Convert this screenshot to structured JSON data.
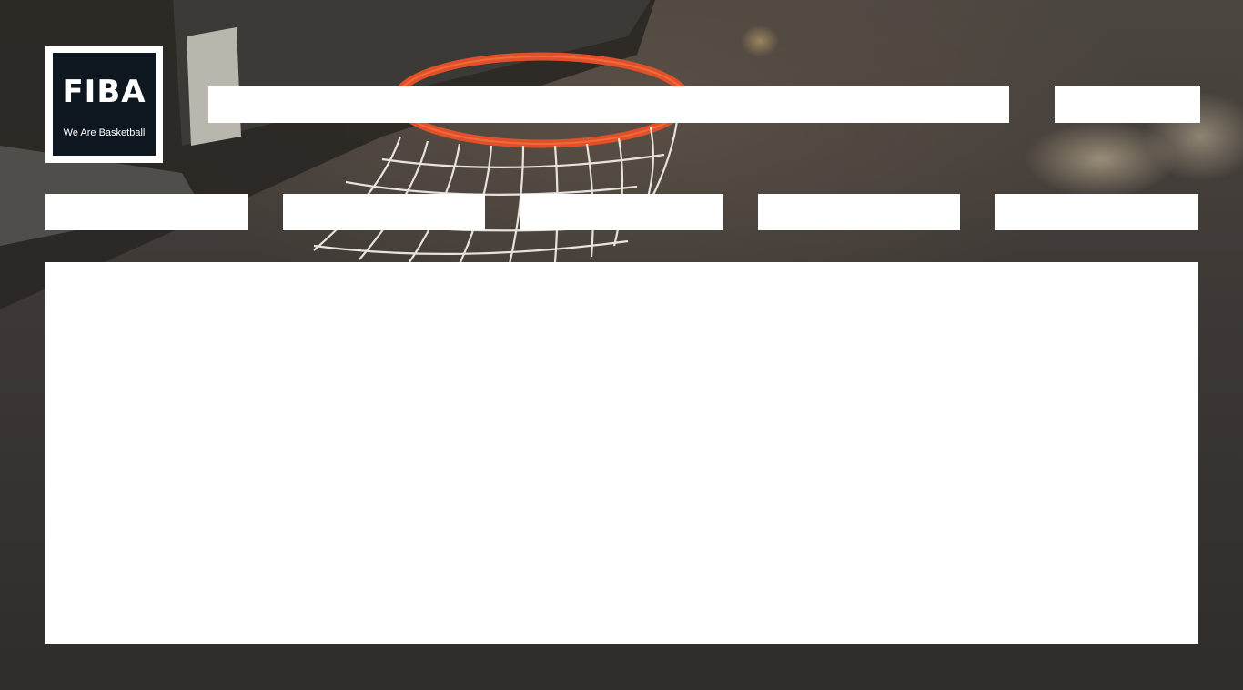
{
  "logo": {
    "wordmark": "FIBA",
    "tagline": "We Are Basketball"
  },
  "colors": {
    "logo_background": "#0f1720",
    "placeholder_block": "#ffffff",
    "rim": "#e0512a"
  },
  "background": {
    "icon": "basketball-hoop-photo"
  }
}
